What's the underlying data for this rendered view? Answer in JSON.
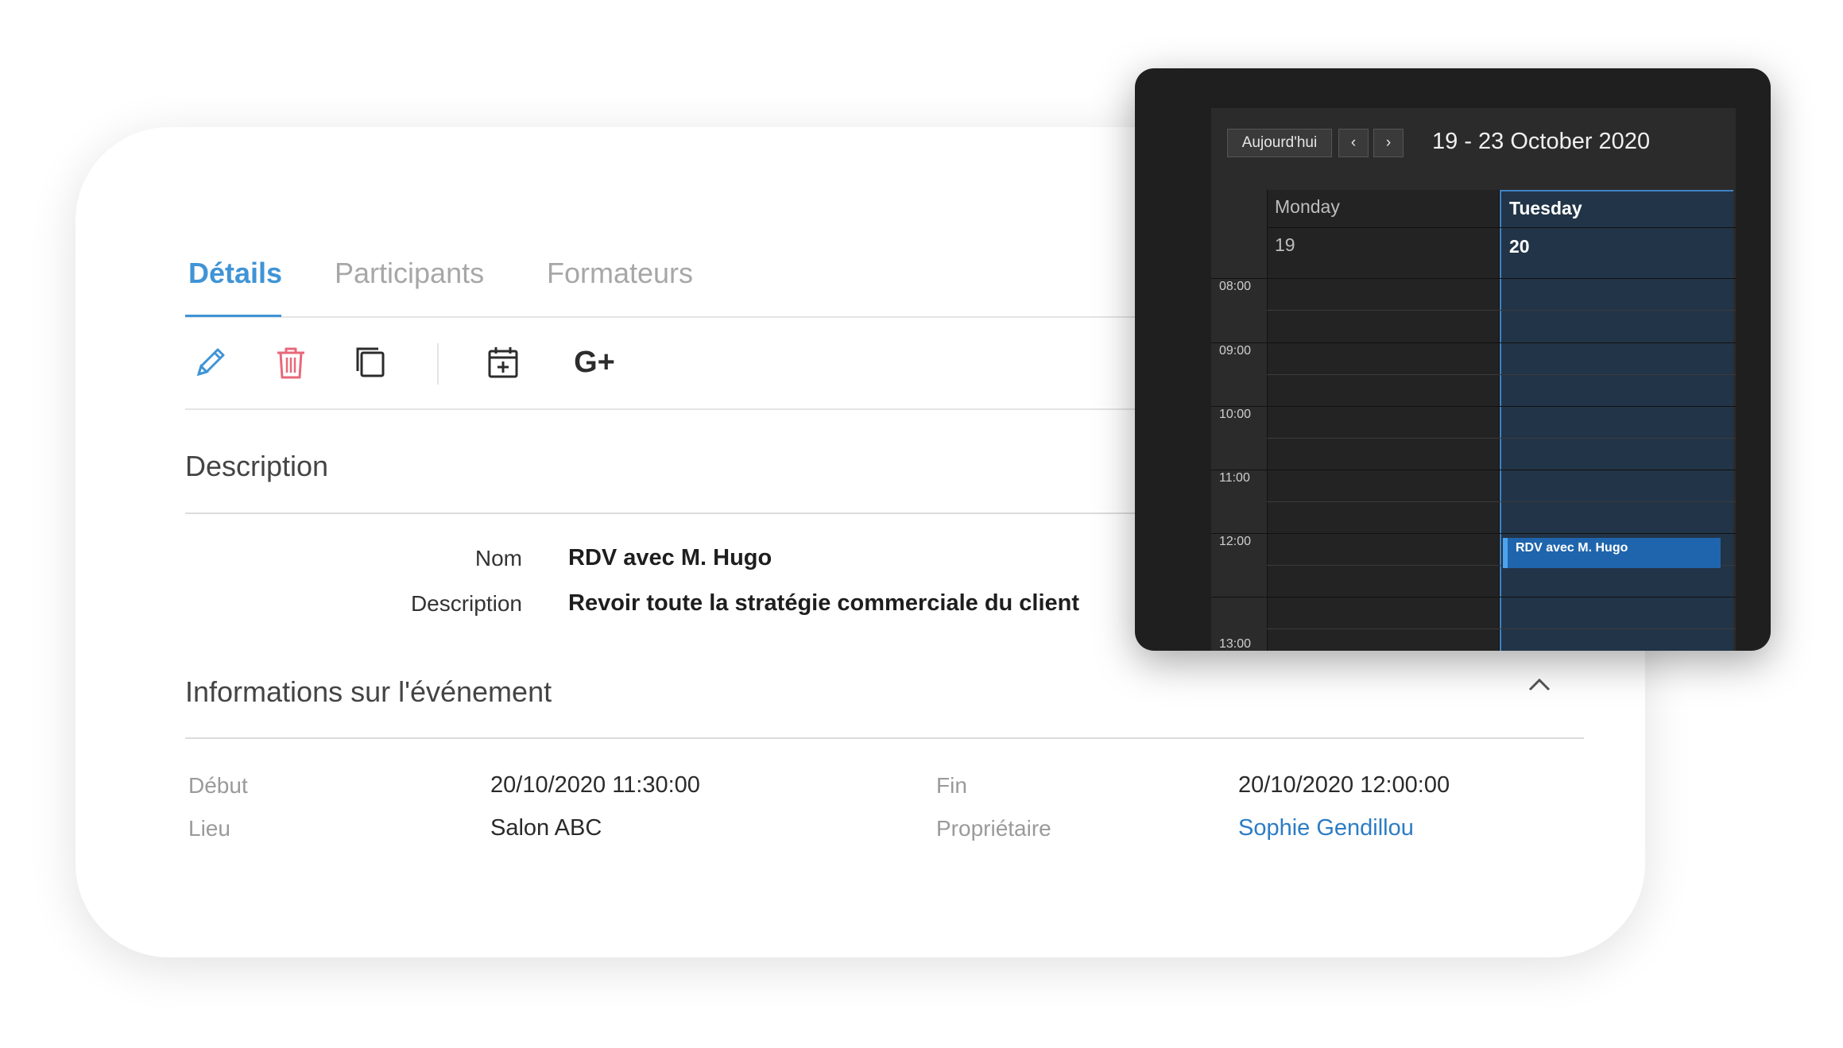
{
  "tabs": [
    {
      "label": "Détails",
      "active": true
    },
    {
      "label": "Participants",
      "active": false
    },
    {
      "label": "Formateurs",
      "active": false
    }
  ],
  "toolbar": {
    "icons": [
      "pencil-icon",
      "trash-icon",
      "duplicate-icon",
      "calendar-add-icon",
      "google-plus-icon"
    ],
    "gplus_label": "G+"
  },
  "description_section": {
    "title": "Description",
    "rows": [
      {
        "label": "Nom",
        "value": "RDV avec M. Hugo"
      },
      {
        "label": "Description",
        "value": "Revoir toute la stratégie commerciale du client"
      }
    ]
  },
  "event_info": {
    "title": "Informations sur l'événement",
    "debut_label": "Début",
    "debut_value": "20/10/2020 11:30:00",
    "fin_label": "Fin",
    "fin_value": "20/10/2020 12:00:00",
    "lieu_label": "Lieu",
    "lieu_value": "Salon ABC",
    "owner_label": "Propriétaire",
    "owner_value": "Sophie Gendillou"
  },
  "calendar": {
    "today_label": "Aujourd'hui",
    "prev_label": "‹",
    "next_label": "›",
    "range": "19 - 23 October 2020",
    "days": [
      {
        "name": "Monday",
        "number": "19",
        "selected": false
      },
      {
        "name": "Tuesday",
        "number": "20",
        "selected": true
      }
    ],
    "times": [
      "08:00",
      "09:00",
      "10:00",
      "11:00",
      "12:00",
      "13:00"
    ],
    "event": {
      "title": "RDV avec M. Hugo"
    }
  },
  "colors": {
    "accent": "#3f94d6",
    "delete": "#e8687a",
    "link": "#2c7cc4",
    "calendar_bg": "#1f1f1f",
    "calendar_selected": "#223447",
    "event": "#1f65ad"
  }
}
